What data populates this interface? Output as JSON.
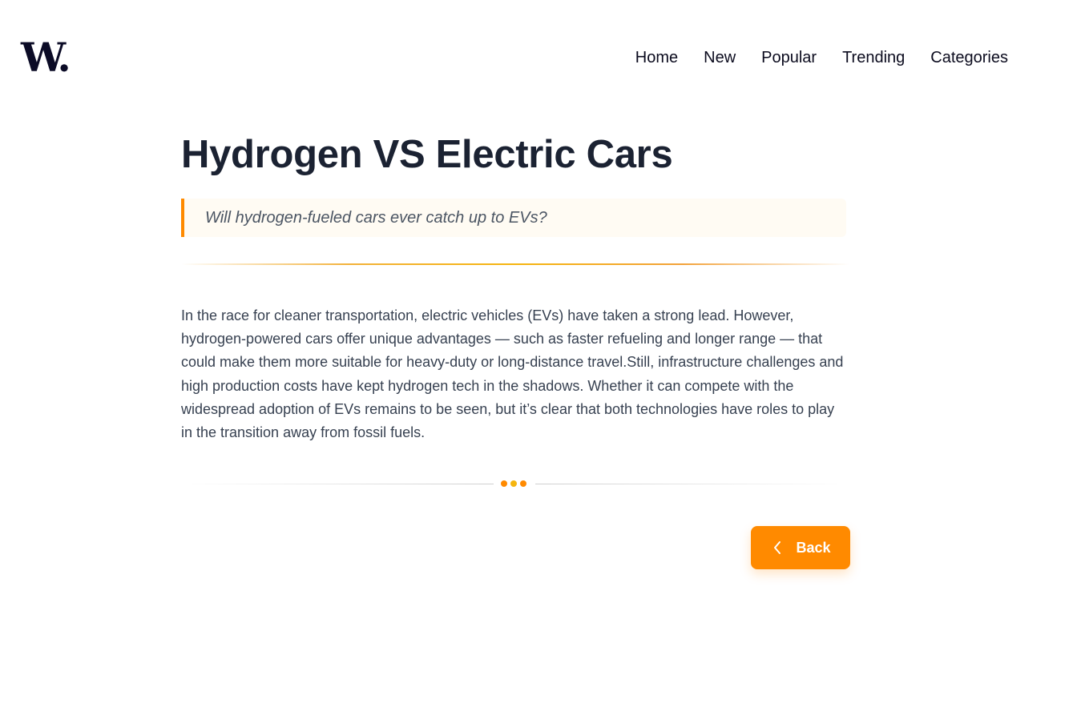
{
  "header": {
    "logo_text": "W.",
    "nav": [
      "Home",
      "New",
      "Popular",
      "Trending",
      "Categories"
    ]
  },
  "article": {
    "title": "Hydrogen VS Electric Cars",
    "subtitle": "Will hydrogen-fueled cars ever catch up to EVs?",
    "body": "In the race for cleaner transportation, electric vehicles (EVs) have taken a strong lead. However, hydrogen-powered cars offer unique advantages — such as faster refueling and longer range — that could make them more suitable for heavy-duty or long-distance travel.Still, infrastructure challenges and high production costs have kept hydrogen tech in the shadows. Whether it can compete with the widespread adoption of EVs remains to be seen, but it’s clear that both technologies have roles to play in the transition away from fossil fuels."
  },
  "actions": {
    "back_label": "Back",
    "back_icon": "chevron-left-icon"
  },
  "colors": {
    "accent": "#ff8a00",
    "dots": [
      "#ff8a00",
      "#f5b50f",
      "#ff8a00"
    ],
    "title": "#1b2232",
    "subtitle_bg": "#fffbf3"
  }
}
